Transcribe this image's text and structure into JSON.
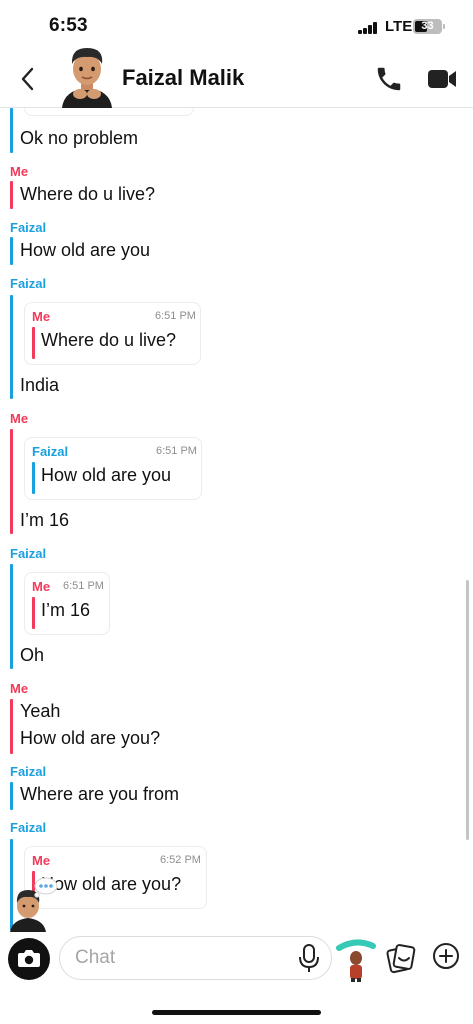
{
  "status_bar": {
    "time": "6:53",
    "network": "LTE",
    "battery": "33"
  },
  "header": {
    "contact_name": "Faizal Malik"
  },
  "messages": [
    {
      "text": "Ok no problem"
    },
    {
      "sender": "Me",
      "text": "Where do u live?"
    },
    {
      "sender": "Faizal",
      "text": "How old are you"
    },
    {
      "sender": "Faizal",
      "quote": {
        "sender": "Me",
        "time": "6:51 PM",
        "text": "Where do u live?"
      },
      "text": "India"
    },
    {
      "sender": "Me",
      "quote": {
        "sender": "Faizal",
        "time": "6:51 PM",
        "text": "How old are you"
      },
      "text": "I’m 16"
    },
    {
      "sender": "Faizal",
      "quote": {
        "sender": "Me",
        "time": "6:51 PM",
        "text": "I’m 16"
      },
      "text": "Oh"
    },
    {
      "sender": "Me",
      "lines": [
        "Yeah",
        "How old are you?"
      ]
    },
    {
      "sender": "Faizal",
      "text": "Where are you from"
    },
    {
      "sender": "Faizal",
      "quote": {
        "sender": "Me",
        "time": "6:52 PM",
        "text": "How old are you?"
      }
    }
  ],
  "composer": {
    "placeholder": "Chat"
  },
  "colors": {
    "me": "#f03c5a",
    "faizal": "#1aa0e0",
    "text": "#111111"
  },
  "icons": [
    "back-icon",
    "phone-icon",
    "video-call-icon",
    "camera-icon",
    "microphone-icon",
    "bitmoji-icon",
    "sticker-icon",
    "plus-icon",
    "typing-bubble-icon"
  ]
}
